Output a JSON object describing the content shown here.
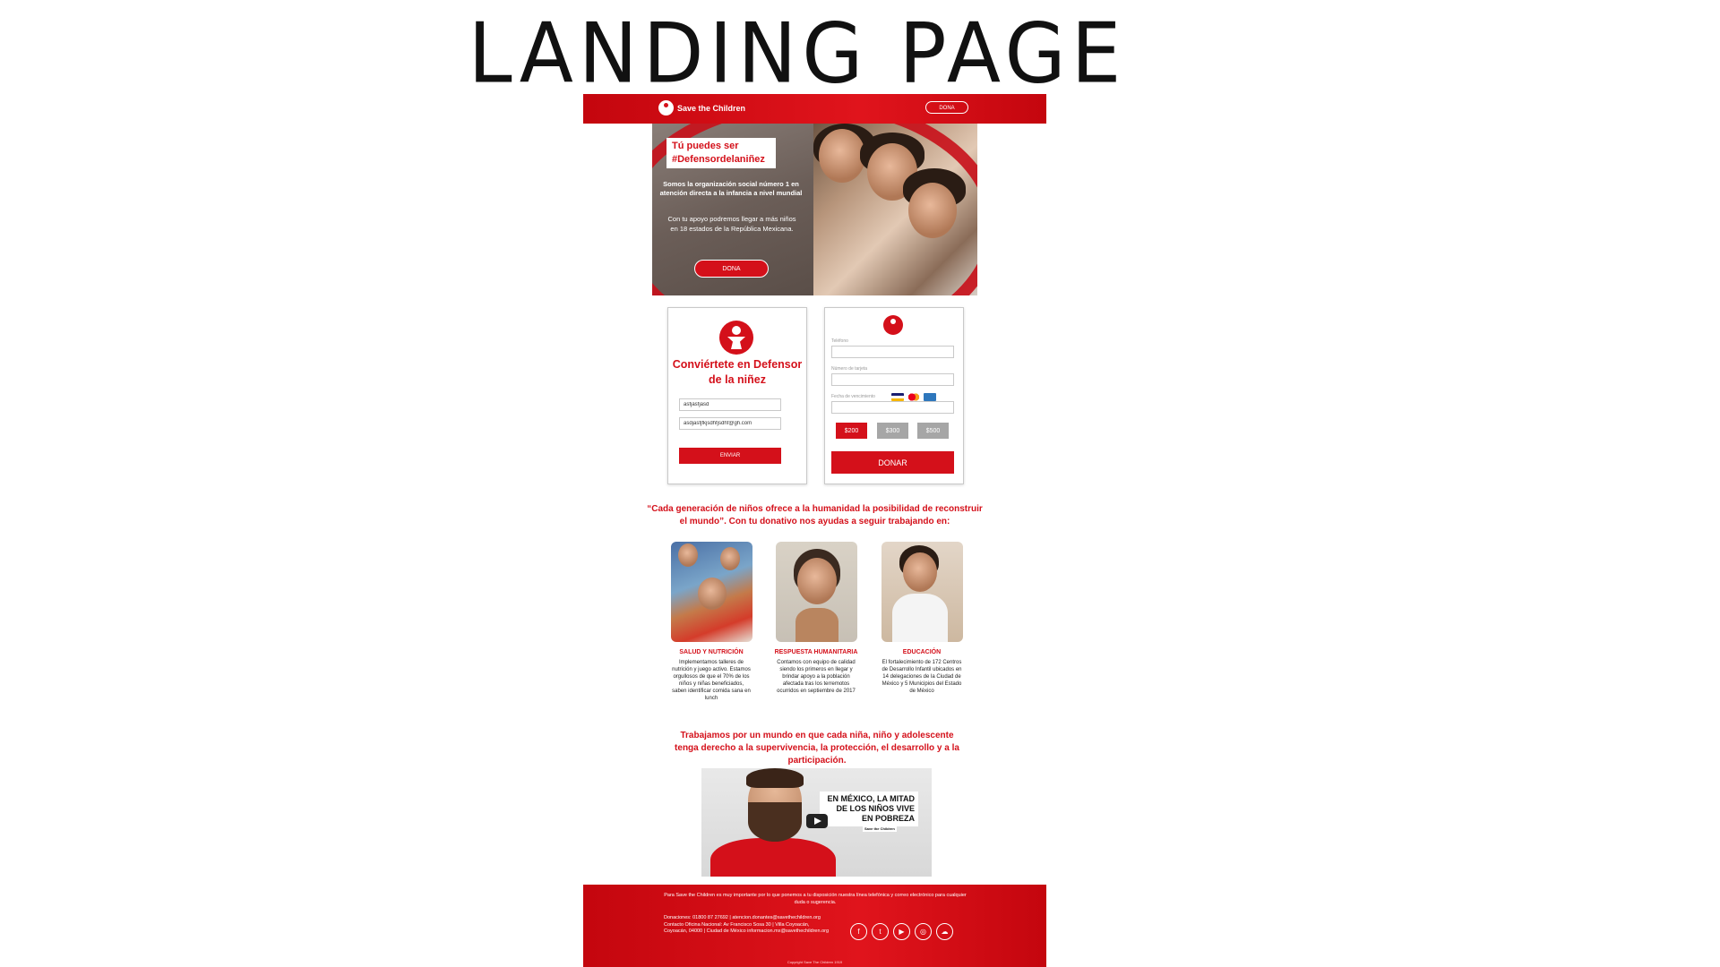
{
  "slide_title": "LANDING PAGE",
  "header": {
    "brand": "Save the Children",
    "donate_label": "DONA"
  },
  "hero": {
    "title": "Tú puedes ser #Defensordelaniñez",
    "subtitle": "Somos la organización social número 1 en atención directa a la infancia a nivel mundial",
    "body": "Con tu apoyo podremos llegar a más niños en 18 estados de la República Mexicana.",
    "button": "DONA"
  },
  "signup_card": {
    "title": "Conviértete en Defensor de la niñez",
    "name_value": "asfjasfjasd",
    "email_value": "asdjasfjfkjsdhfjsdhf@gh.com",
    "send_label": "ENVIAR"
  },
  "donation_card": {
    "phone_label": "Teléfono",
    "card_number_label": "Número de tarjeta",
    "expiry_label": "Fecha de vencimiento",
    "amounts": [
      "$200",
      "$300",
      "$500"
    ],
    "donate_label": "DONAR"
  },
  "quote": "“Cada generación de niños ofrece a la humanidad la posibilidad de reconstruir el mundo”. Con tu donativo nos ayudas a seguir trabajando en:",
  "programs": [
    {
      "title": "SALUD Y NUTRICIÓN",
      "text": "Implementamos talleres de nutrición y juego activo. Estamos orgullosos de que el 70% de los niños y niñas beneficiados, saben identificar comida sana en lunch"
    },
    {
      "title": "RESPUESTA HUMANITARIA",
      "text": "Contamos con equipo de calidad siendo los primeros en llegar y brindar apoyo a la población afectada tras los terremotos ocurridos en septiembre de 2017"
    },
    {
      "title": "EDUCACIÓN",
      "text": "El fortalecimiento de 172 Centros de Desarrollo Infantil ubicados en 14 delegaciones de la Ciudad de México y 5 Municipios del Estado de México"
    }
  ],
  "mission": "Trabajamos por un mundo en que cada niña, niño y adolescente tenga derecho a la supervivencia, la protección, el desarrollo y a la participación.",
  "video": {
    "headline": "EN MÉXICO, LA MITAD DE LOS NIÑOS VIVE EN POBREZA",
    "brand": "Save the Children"
  },
  "footer": {
    "intro": "Para Save the Children es muy importante por lo que ponemos a tu disposición nuestra línea telefónica y correo electrónico para cualquier duda o sugerencia.",
    "contact": "Donaciones: 01800 87 27692 | atencion.donantes@savethechildren.org Contacto Oficina Nacional: Av Francisco Sosa 30 | Villa Coyoacán, Coyoacán, 04000 | Ciudad de México informacion.mx@savethechildren.org",
    "copyright": "Copyright Save The Children 1919",
    "socials": [
      "f",
      "t",
      "▶",
      "◎",
      "☁"
    ]
  },
  "colors": {
    "brand_red": "#d4101a",
    "inactive_gray": "#a6a6a6"
  }
}
